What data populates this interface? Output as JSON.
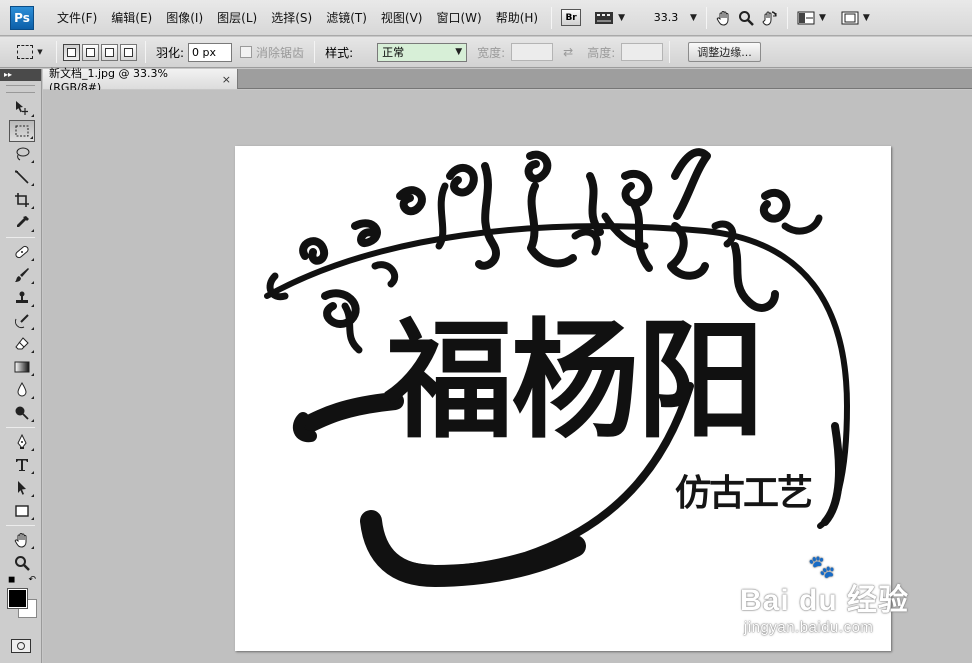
{
  "app": {
    "logo": "Ps",
    "menus": [
      "文件(F)",
      "编辑(E)",
      "图像(I)",
      "图层(L)",
      "选择(S)",
      "滤镜(T)",
      "视图(V)",
      "窗口(W)",
      "帮助(H)"
    ],
    "bridge_label": "Br",
    "zoom": "33.3"
  },
  "options": {
    "feather_label": "羽化:",
    "feather_value": "0 px",
    "antialias_label": "消除锯齿",
    "style_label": "样式:",
    "style_value": "正常",
    "width_label": "宽度:",
    "height_label": "高度:",
    "refine_edge_label": "调整边缘..."
  },
  "document": {
    "tab_title": "新文档_1.jpg @ 33.3%(RGB/8#)",
    "close_glyph": "×",
    "main_text": "福杨阳",
    "sub_text": "仿古工艺"
  },
  "watermark": {
    "brand": "Bai du 经验",
    "url": "jingyan.baidu.com"
  },
  "colors": {
    "foreground": "#000000",
    "background": "#ffffff",
    "style_select_bg": "#d7efd7"
  }
}
